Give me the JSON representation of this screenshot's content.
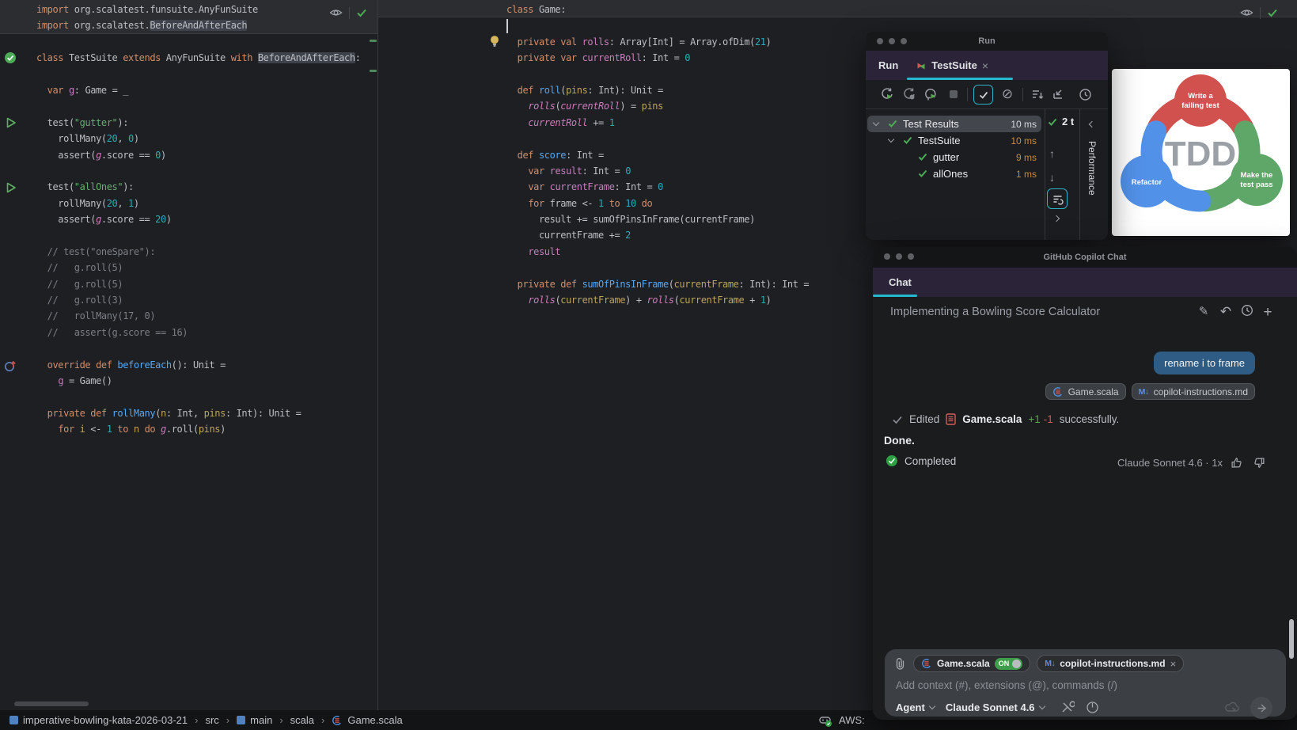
{
  "icons": {
    "close": "×",
    "plus": "+",
    "undo": "↶",
    "quill": "✎",
    "up_arrow": "↑",
    "down_arrow": "↓",
    "ignored": "⊘",
    "separator": "›"
  },
  "editor": {
    "left": {
      "lines": [
        {
          "pin": true,
          "s": [
            [
              "k",
              "import"
            ],
            [
              "d",
              " org.scalatest.funsuite.AnyFunSuite"
            ]
          ]
        },
        {
          "pin": true,
          "s": [
            [
              "k",
              "import"
            ],
            [
              "d",
              " org.scalatest."
            ],
            [
              "h",
              "BeforeAndAfterEach"
            ]
          ]
        },
        {
          "s": []
        },
        {
          "s": [
            [
              "k",
              "class"
            ],
            [
              "d",
              " TestSuite "
            ],
            [
              "k",
              "extends"
            ],
            [
              "d",
              " AnyFunSuite "
            ],
            [
              "k",
              "with"
            ],
            [
              "d",
              " "
            ],
            [
              "h",
              "BeforeAndAfterEach"
            ],
            [
              "d",
              ":"
            ]
          ]
        },
        {
          "s": []
        },
        {
          "s": [
            [
              "d",
              "  "
            ],
            [
              "k",
              "var"
            ],
            [
              "d",
              " "
            ],
            [
              "p",
              "g"
            ],
            [
              "d",
              ": Game = _"
            ]
          ]
        },
        {
          "s": []
        },
        {
          "s": [
            [
              "d",
              "  test("
            ],
            [
              "s",
              "\"gutter\""
            ],
            [
              "d",
              "):"
            ]
          ]
        },
        {
          "s": [
            [
              "d",
              "    rollMany("
            ],
            [
              "n",
              "20"
            ],
            [
              "d",
              ", "
            ],
            [
              "n",
              "0"
            ],
            [
              "d",
              ")"
            ]
          ]
        },
        {
          "s": [
            [
              "d",
              "    assert("
            ],
            [
              "i",
              "g"
            ],
            [
              "d",
              ".score == "
            ],
            [
              "n",
              "0"
            ],
            [
              "d",
              ")"
            ]
          ]
        },
        {
          "s": []
        },
        {
          "s": [
            [
              "d",
              "  test("
            ],
            [
              "s",
              "\"allOnes\""
            ],
            [
              "d",
              "):"
            ]
          ]
        },
        {
          "s": [
            [
              "d",
              "    rollMany("
            ],
            [
              "n",
              "20"
            ],
            [
              "d",
              ", "
            ],
            [
              "n",
              "1"
            ],
            [
              "d",
              ")"
            ]
          ]
        },
        {
          "s": [
            [
              "d",
              "    assert("
            ],
            [
              "i",
              "g"
            ],
            [
              "d",
              ".score == "
            ],
            [
              "n",
              "20"
            ],
            [
              "d",
              ")"
            ]
          ]
        },
        {
          "s": []
        },
        {
          "s": [
            [
              "c",
              "  // test(\"oneSpare\"):"
            ]
          ]
        },
        {
          "s": [
            [
              "c",
              "  //   g.roll(5)"
            ]
          ]
        },
        {
          "s": [
            [
              "c",
              "  //   g.roll(5)"
            ]
          ]
        },
        {
          "s": [
            [
              "c",
              "  //   g.roll(3)"
            ]
          ]
        },
        {
          "s": [
            [
              "c",
              "  //   rollMany(17, 0)"
            ]
          ]
        },
        {
          "s": [
            [
              "c",
              "  //   assert(g.score == 16)"
            ]
          ]
        },
        {
          "s": []
        },
        {
          "s": [
            [
              "d",
              "  "
            ],
            [
              "k",
              "override"
            ],
            [
              "d",
              " "
            ],
            [
              "k",
              "def"
            ],
            [
              "d",
              " "
            ],
            [
              "m",
              "beforeEach"
            ],
            [
              "d",
              "(): Unit ="
            ]
          ]
        },
        {
          "s": [
            [
              "d",
              "    "
            ],
            [
              "p",
              "g"
            ],
            [
              "d",
              " = Game()"
            ]
          ]
        },
        {
          "s": []
        },
        {
          "s": [
            [
              "d",
              "  "
            ],
            [
              "k",
              "private"
            ],
            [
              "d",
              " "
            ],
            [
              "k",
              "def"
            ],
            [
              "d",
              " "
            ],
            [
              "m",
              "rollMany"
            ],
            [
              "d",
              "("
            ],
            [
              "t",
              "n"
            ],
            [
              "d",
              ": Int, "
            ],
            [
              "t",
              "pins"
            ],
            [
              "d",
              ": Int): Unit ="
            ]
          ]
        },
        {
          "s": [
            [
              "d",
              "    "
            ],
            [
              "k",
              "for"
            ],
            [
              "d",
              " "
            ],
            [
              "t",
              "i"
            ],
            [
              "d",
              " <- "
            ],
            [
              "n",
              "1"
            ],
            [
              "d",
              " "
            ],
            [
              "k",
              "to"
            ],
            [
              "d",
              " "
            ],
            [
              "t",
              "n"
            ],
            [
              "d",
              " "
            ],
            [
              "k",
              "do"
            ],
            [
              "d",
              " "
            ],
            [
              "i",
              "g"
            ],
            [
              "d",
              ".roll("
            ],
            [
              "t",
              "pins"
            ],
            [
              "d",
              ")"
            ]
          ]
        }
      ]
    },
    "middle": {
      "lines": [
        {
          "pin": true,
          "s": [
            [
              "k",
              "class"
            ],
            [
              "d",
              " Game:"
            ]
          ]
        },
        {
          "s": []
        },
        {
          "s": [
            [
              "d",
              "  "
            ],
            [
              "k",
              "private"
            ],
            [
              "d",
              " "
            ],
            [
              "k",
              "val"
            ],
            [
              "d",
              " "
            ],
            [
              "p",
              "rolls"
            ],
            [
              "d",
              ": Array[Int] = Array.ofDim("
            ],
            [
              "n",
              "21"
            ],
            [
              "d",
              ")"
            ]
          ]
        },
        {
          "s": [
            [
              "d",
              "  "
            ],
            [
              "k",
              "private"
            ],
            [
              "d",
              " "
            ],
            [
              "k",
              "var"
            ],
            [
              "d",
              " "
            ],
            [
              "p",
              "currentRoll"
            ],
            [
              "d",
              ": Int = "
            ],
            [
              "n",
              "0"
            ]
          ]
        },
        {
          "s": []
        },
        {
          "s": [
            [
              "d",
              "  "
            ],
            [
              "k",
              "def"
            ],
            [
              "d",
              " "
            ],
            [
              "m",
              "roll"
            ],
            [
              "d",
              "("
            ],
            [
              "t",
              "pins"
            ],
            [
              "d",
              ": Int): Unit ="
            ]
          ]
        },
        {
          "s": [
            [
              "d",
              "    "
            ],
            [
              "i",
              "rolls"
            ],
            [
              "d",
              "("
            ],
            [
              "i",
              "currentRoll"
            ],
            [
              "d",
              ") = "
            ],
            [
              "t",
              "pins"
            ]
          ]
        },
        {
          "s": [
            [
              "d",
              "    "
            ],
            [
              "i",
              "currentRoll"
            ],
            [
              "d",
              " += "
            ],
            [
              "n",
              "1"
            ]
          ]
        },
        {
          "s": []
        },
        {
          "s": [
            [
              "d",
              "  "
            ],
            [
              "k",
              "def"
            ],
            [
              "d",
              " "
            ],
            [
              "m",
              "score"
            ],
            [
              "d",
              ": Int ="
            ]
          ]
        },
        {
          "s": [
            [
              "d",
              "    "
            ],
            [
              "k",
              "var"
            ],
            [
              "d",
              " "
            ],
            [
              "p",
              "result"
            ],
            [
              "d",
              ": Int = "
            ],
            [
              "n",
              "0"
            ]
          ]
        },
        {
          "s": [
            [
              "d",
              "    "
            ],
            [
              "k",
              "var"
            ],
            [
              "d",
              " "
            ],
            [
              "p",
              "currentFrame"
            ],
            [
              "d",
              ": Int = "
            ],
            [
              "n",
              "0"
            ]
          ]
        },
        {
          "s": [
            [
              "d",
              "    "
            ],
            [
              "k",
              "for"
            ],
            [
              "d",
              " frame <- "
            ],
            [
              "n",
              "1"
            ],
            [
              "d",
              " "
            ],
            [
              "k",
              "to"
            ],
            [
              "d",
              " "
            ],
            [
              "n",
              "10"
            ],
            [
              "d",
              " "
            ],
            [
              "k",
              "do"
            ]
          ]
        },
        {
          "s": [
            [
              "d",
              "      result += sumOfPinsInFrame(currentFrame)"
            ]
          ]
        },
        {
          "s": [
            [
              "d",
              "      currentFrame += "
            ],
            [
              "n",
              "2"
            ]
          ]
        },
        {
          "s": [
            [
              "d",
              "    "
            ],
            [
              "p",
              "result"
            ]
          ]
        },
        {
          "s": []
        },
        {
          "s": [
            [
              "d",
              "  "
            ],
            [
              "k",
              "private"
            ],
            [
              "d",
              " "
            ],
            [
              "k",
              "def"
            ],
            [
              "d",
              " "
            ],
            [
              "m",
              "sumOfPinsInFrame"
            ],
            [
              "d",
              "("
            ],
            [
              "t",
              "currentFrame"
            ],
            [
              "d",
              ": Int): Int ="
            ]
          ]
        },
        {
          "s": [
            [
              "d",
              "    "
            ],
            [
              "i",
              "rolls"
            ],
            [
              "d",
              "("
            ],
            [
              "t",
              "currentFrame"
            ],
            [
              "d",
              ") + "
            ],
            [
              "i",
              "rolls"
            ],
            [
              "d",
              "("
            ],
            [
              "t",
              "currentFrame"
            ],
            [
              "d",
              " + "
            ],
            [
              "n",
              "1"
            ],
            [
              "d",
              ")"
            ]
          ]
        }
      ]
    }
  },
  "run_window": {
    "title": "Run",
    "tab_bar_label": "Run",
    "tab_label": "TestSuite",
    "tree": {
      "rows": [
        {
          "depth": 0,
          "label": "Test Results",
          "time": "10 ms",
          "time_style": "light",
          "selected": true,
          "expanded": true
        },
        {
          "depth": 1,
          "label": "TestSuite",
          "time": "10 ms",
          "time_style": "orange",
          "expanded": true
        },
        {
          "depth": 2,
          "label": "gutter",
          "time": "9 ms",
          "time_style": "orange"
        },
        {
          "depth": 2,
          "label": "allOnes",
          "time": "1 ms",
          "time_style": "orange"
        }
      ]
    },
    "passed_summary": "2 t",
    "performance_tab": "Performance"
  },
  "tdd": {
    "center": "TDD",
    "steps": [
      {
        "label1": "Write a",
        "label2": "failing test",
        "color": "#D0514D"
      },
      {
        "label1": "Make the",
        "label2": "test pass",
        "color": "#5FA768"
      },
      {
        "label1": "Refactor",
        "label2": "",
        "color": "#5291E8"
      }
    ]
  },
  "copilot": {
    "title": "GitHub Copilot Chat",
    "tab": "Chat",
    "conversation_title": "Implementing a Bowling Score Calculator",
    "user_message": "rename i to frame",
    "message_chips": [
      {
        "icon": "scala",
        "label": "Game.scala"
      },
      {
        "icon": "markdown",
        "label": "copilot-instructions.md"
      }
    ],
    "edited": {
      "verb": "Edited",
      "file": "Game.scala",
      "added": "+1",
      "removed": "-1",
      "suffix": "successfully."
    },
    "done": "Done.",
    "completed": "Completed",
    "model_usage": "Claude Sonnet 4.6 · 1x",
    "input": {
      "chips": [
        {
          "icon": "scala",
          "label": "Game.scala",
          "toggle": "ON"
        },
        {
          "icon": "markdown",
          "label": "copilot-instructions.md",
          "close": "×"
        }
      ],
      "placeholder": "Add context (#), extensions (@), commands (/)",
      "mode": "Agent",
      "model": "Claude Sonnet 4.6"
    },
    "markdown_glyph": "M↓"
  },
  "statusbar": {
    "breadcrumbs": [
      {
        "icon": "module",
        "label": "imperative-bowling-kata-2026-03-21"
      },
      {
        "icon": "",
        "label": "src"
      },
      {
        "icon": "module",
        "label": "main"
      },
      {
        "icon": "",
        "label": "scala"
      },
      {
        "icon": "scala",
        "label": "Game.scala"
      }
    ],
    "aws_label": "AWS:"
  }
}
